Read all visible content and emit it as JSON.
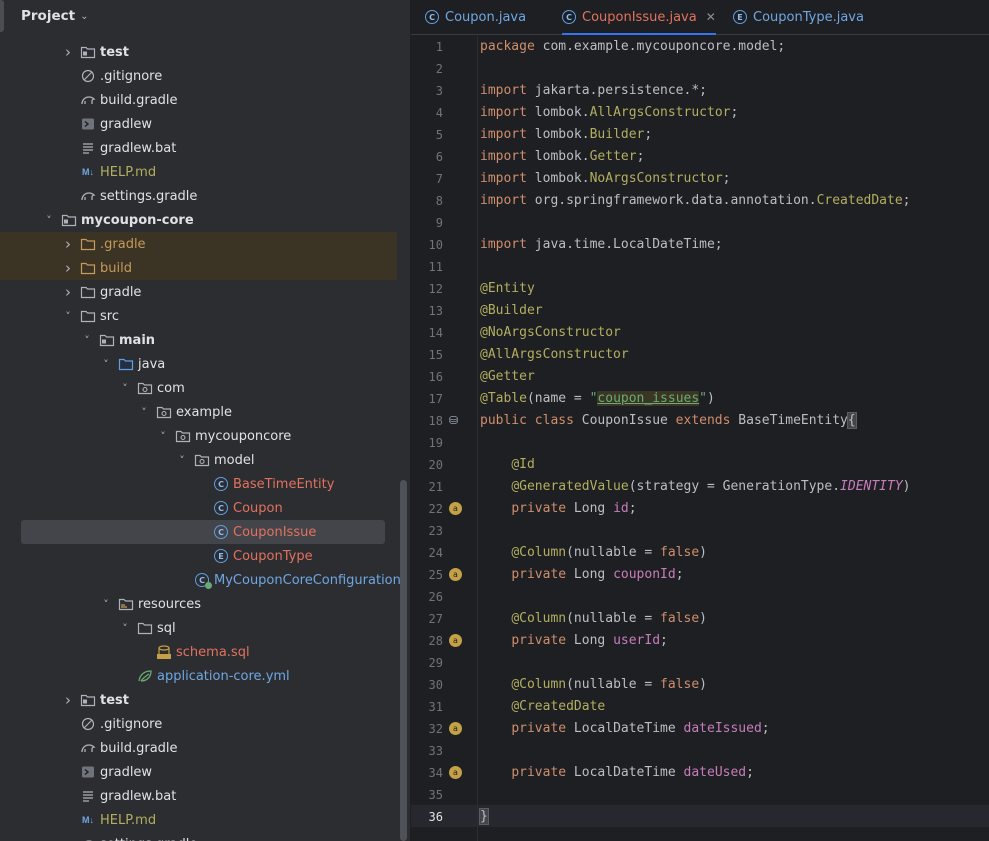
{
  "sidebar": {
    "title": "Project",
    "rows": [
      {
        "label": "test",
        "indent": 1,
        "arrow": "right",
        "icon": "module-folder",
        "color": "default",
        "bold": true
      },
      {
        "label": ".gitignore",
        "indent": 1,
        "arrow": "none",
        "icon": "ignore-file",
        "color": "default"
      },
      {
        "label": "build.gradle",
        "indent": 1,
        "arrow": "none",
        "icon": "gradle-elephant",
        "color": "default"
      },
      {
        "label": "gradlew",
        "indent": 1,
        "arrow": "none",
        "icon": "shell-script",
        "color": "default"
      },
      {
        "label": "gradlew.bat",
        "indent": 1,
        "arrow": "none",
        "icon": "text-file",
        "color": "default"
      },
      {
        "label": "HELP.md",
        "indent": 1,
        "arrow": "none",
        "icon": "markdown",
        "color": "md"
      },
      {
        "label": "settings.gradle",
        "indent": 1,
        "arrow": "none",
        "icon": "gradle-elephant",
        "color": "default"
      },
      {
        "label": "mycoupon-core",
        "indent": 0,
        "arrow": "down",
        "icon": "module-folder",
        "color": "default",
        "bold": true
      },
      {
        "label": ".gradle",
        "indent": 1,
        "arrow": "right",
        "icon": "folder-ignored",
        "color": "ignored",
        "ignored": true
      },
      {
        "label": "build",
        "indent": 1,
        "arrow": "right",
        "icon": "folder-ignored",
        "color": "ignored",
        "ignored": true
      },
      {
        "label": "gradle",
        "indent": 1,
        "arrow": "right",
        "icon": "folder",
        "color": "default"
      },
      {
        "label": "src",
        "indent": 1,
        "arrow": "down",
        "icon": "folder",
        "color": "default"
      },
      {
        "label": "main",
        "indent": 2,
        "arrow": "down",
        "icon": "module-folder",
        "color": "default",
        "bold": true
      },
      {
        "label": "java",
        "indent": 3,
        "arrow": "down",
        "icon": "source-folder",
        "color": "default"
      },
      {
        "label": "com",
        "indent": 4,
        "arrow": "down",
        "icon": "package",
        "color": "default"
      },
      {
        "label": "example",
        "indent": 5,
        "arrow": "down",
        "icon": "package",
        "color": "default"
      },
      {
        "label": "mycouponcore",
        "indent": 6,
        "arrow": "down",
        "icon": "package",
        "color": "default"
      },
      {
        "label": "model",
        "indent": 7,
        "arrow": "down",
        "icon": "package",
        "color": "default"
      },
      {
        "label": "BaseTimeEntity",
        "indent": 8,
        "arrow": "none",
        "icon": "class",
        "color": "mod"
      },
      {
        "label": "Coupon",
        "indent": 8,
        "arrow": "none",
        "icon": "class",
        "color": "mod"
      },
      {
        "label": "CouponIssue",
        "indent": 8,
        "arrow": "none",
        "icon": "class",
        "color": "mod",
        "selected": true
      },
      {
        "label": "CouponType",
        "indent": 8,
        "arrow": "none",
        "icon": "enum",
        "color": "mod"
      },
      {
        "label": "MyCouponCoreConfiguration",
        "indent": 7,
        "arrow": "none",
        "icon": "config-class",
        "color": "blue"
      },
      {
        "label": "resources",
        "indent": 3,
        "arrow": "down",
        "icon": "resources-folder",
        "color": "default"
      },
      {
        "label": "sql",
        "indent": 4,
        "arrow": "down",
        "icon": "folder",
        "color": "default"
      },
      {
        "label": "schema.sql",
        "indent": 5,
        "arrow": "none",
        "icon": "sql-file",
        "color": "mod"
      },
      {
        "label": "application-core.yml",
        "indent": 4,
        "arrow": "none",
        "icon": "spring-leaf",
        "color": "blue"
      },
      {
        "label": "test",
        "indent": 1,
        "arrow": "right",
        "icon": "module-folder",
        "color": "default",
        "bold": true
      },
      {
        "label": ".gitignore",
        "indent": 1,
        "arrow": "none",
        "icon": "ignore-file",
        "color": "default"
      },
      {
        "label": "build.gradle",
        "indent": 1,
        "arrow": "none",
        "icon": "gradle-elephant",
        "color": "default"
      },
      {
        "label": "gradlew",
        "indent": 1,
        "arrow": "none",
        "icon": "shell-script",
        "color": "default"
      },
      {
        "label": "gradlew.bat",
        "indent": 1,
        "arrow": "none",
        "icon": "text-file",
        "color": "default"
      },
      {
        "label": "HELP.md",
        "indent": 1,
        "arrow": "none",
        "icon": "markdown",
        "color": "md"
      },
      {
        "label": "settings.gradle",
        "indent": 1,
        "arrow": "none",
        "icon": "gradle-elephant",
        "color": "default"
      }
    ]
  },
  "tabs": [
    {
      "label": "Coupon.java",
      "icon": "C",
      "active": false
    },
    {
      "label": "CouponIssue.java",
      "icon": "C",
      "active": true,
      "closable": true
    },
    {
      "label": "CouponType.java",
      "icon": "E",
      "active": false
    }
  ],
  "editor": {
    "current_line": 36,
    "gutter_marks": {
      "18": "database-icon",
      "22": "bean-field",
      "25": "bean-field",
      "28": "bean-field",
      "32": "bean-field",
      "34": "bean-field"
    },
    "lines": [
      [
        [
          "kw",
          "package"
        ],
        [
          "p",
          " com.example.mycouponcore.model;"
        ]
      ],
      [],
      [
        [
          "kw",
          "import"
        ],
        [
          "p",
          " jakarta.persistence.*;"
        ]
      ],
      [
        [
          "kw",
          "import"
        ],
        [
          "p",
          " lombok."
        ],
        [
          "an",
          "AllArgsConstructor"
        ],
        [
          "p",
          ";"
        ]
      ],
      [
        [
          "kw",
          "import"
        ],
        [
          "p",
          " lombok."
        ],
        [
          "an",
          "Builder"
        ],
        [
          "p",
          ";"
        ]
      ],
      [
        [
          "kw",
          "import"
        ],
        [
          "p",
          " lombok."
        ],
        [
          "an",
          "Getter"
        ],
        [
          "p",
          ";"
        ]
      ],
      [
        [
          "kw",
          "import"
        ],
        [
          "p",
          " lombok."
        ],
        [
          "an",
          "NoArgsConstructor"
        ],
        [
          "p",
          ";"
        ]
      ],
      [
        [
          "kw",
          "import"
        ],
        [
          "p",
          " org.springframework.data.annotation."
        ],
        [
          "an",
          "CreatedDate"
        ],
        [
          "p",
          ";"
        ]
      ],
      [],
      [
        [
          "kw",
          "import"
        ],
        [
          "p",
          " java.time.LocalDateTime;"
        ]
      ],
      [],
      [
        [
          "an",
          "@Entity"
        ]
      ],
      [
        [
          "an",
          "@Builder"
        ]
      ],
      [
        [
          "an",
          "@NoArgsConstructor"
        ]
      ],
      [
        [
          "an",
          "@AllArgsConstructor"
        ]
      ],
      [
        [
          "an",
          "@Getter"
        ]
      ],
      [
        [
          "an",
          "@Table"
        ],
        [
          "p",
          "(name = "
        ],
        [
          "str",
          "\""
        ],
        [
          "strul",
          "coupon_issues"
        ],
        [
          "str",
          "\""
        ],
        [
          "p",
          ")"
        ]
      ],
      [
        [
          "kw",
          "public class"
        ],
        [
          "p",
          " CouponIssue "
        ],
        [
          "kw",
          "extends"
        ],
        [
          "p",
          " BaseTimeEntity"
        ],
        [
          "brace",
          "{"
        ]
      ],
      [],
      [
        [
          "p",
          "    "
        ],
        [
          "an",
          "@Id"
        ]
      ],
      [
        [
          "p",
          "    "
        ],
        [
          "an",
          "@GeneratedValue"
        ],
        [
          "p",
          "(strategy = GenerationType."
        ],
        [
          "ital",
          "IDENTITY"
        ],
        [
          "p",
          ")"
        ]
      ],
      [
        [
          "p",
          "    "
        ],
        [
          "kw",
          "private"
        ],
        [
          "p",
          " Long "
        ],
        [
          "fld",
          "id"
        ],
        [
          "p",
          ";"
        ]
      ],
      [],
      [
        [
          "p",
          "    "
        ],
        [
          "an",
          "@Column"
        ],
        [
          "p",
          "(nullable = "
        ],
        [
          "kw",
          "false"
        ],
        [
          "p",
          ")"
        ]
      ],
      [
        [
          "p",
          "    "
        ],
        [
          "kw",
          "private"
        ],
        [
          "p",
          " Long "
        ],
        [
          "fld",
          "couponId"
        ],
        [
          "p",
          ";"
        ]
      ],
      [],
      [
        [
          "p",
          "    "
        ],
        [
          "an",
          "@Column"
        ],
        [
          "p",
          "(nullable = "
        ],
        [
          "kw",
          "false"
        ],
        [
          "p",
          ")"
        ]
      ],
      [
        [
          "p",
          "    "
        ],
        [
          "kw",
          "private"
        ],
        [
          "p",
          " Long "
        ],
        [
          "fld",
          "userId"
        ],
        [
          "p",
          ";"
        ]
      ],
      [],
      [
        [
          "p",
          "    "
        ],
        [
          "an",
          "@Column"
        ],
        [
          "p",
          "(nullable = "
        ],
        [
          "kw",
          "false"
        ],
        [
          "p",
          ")"
        ]
      ],
      [
        [
          "p",
          "    "
        ],
        [
          "an",
          "@CreatedDate"
        ]
      ],
      [
        [
          "p",
          "    "
        ],
        [
          "kw",
          "private"
        ],
        [
          "p",
          " LocalDateTime "
        ],
        [
          "fld",
          "dateIssued"
        ],
        [
          "p",
          ";"
        ]
      ],
      [],
      [
        [
          "p",
          "    "
        ],
        [
          "kw",
          "private"
        ],
        [
          "p",
          " LocalDateTime "
        ],
        [
          "fld",
          "dateUsed"
        ],
        [
          "p",
          ";"
        ]
      ],
      [],
      [
        [
          "brace",
          "}"
        ]
      ]
    ]
  },
  "colors": {
    "accent": "#3574f0",
    "modified": "#e2725f",
    "ignored_bg": "#3b3424",
    "keyword": "#cf8e6d",
    "annotation": "#b3ae60",
    "string": "#6aab73",
    "field": "#c77dbb"
  }
}
